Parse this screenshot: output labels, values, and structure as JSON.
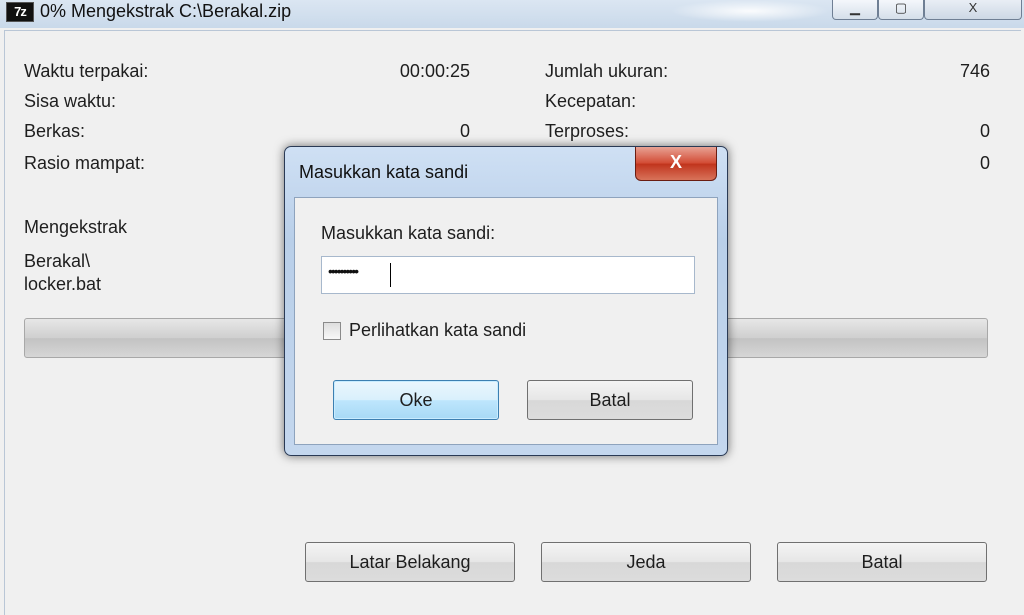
{
  "window": {
    "icon_text": "7z",
    "title": "0% Mengekstrak C:\\Berakal.zip",
    "minimize_glyph": "▁",
    "maximize_glyph": "▢",
    "close_glyph": "X"
  },
  "stats": {
    "elapsed_label": "Waktu terpakai:",
    "elapsed_value": "00:00:25",
    "remaining_label": "Sisa waktu:",
    "files_label": "Berkas:",
    "files_value": "0",
    "ratio_label": "Rasio mampat:",
    "total_size_label": "Jumlah ukuran:",
    "total_size_value": "746",
    "speed_label": "Kecepatan:",
    "processed_label": "Terproses:",
    "processed_value": "0",
    "right_row4_value": "0"
  },
  "status": {
    "action": "Mengekstrak",
    "path_line1": "Berakal\\",
    "path_line2": "locker.bat",
    "progress": 0
  },
  "buttons": {
    "background": "Latar Belakang",
    "pause": "Jeda",
    "cancel": "Batal"
  },
  "password_dialog": {
    "title": "Masukkan kata sandi",
    "close_glyph": "X",
    "prompt": "Masukkan kata sandi:",
    "password_masked": "••••••••••",
    "show_password_label": "Perlihatkan kata sandi",
    "show_password_checked": false,
    "ok_label": "Oke",
    "cancel_label": "Batal"
  },
  "colors": {
    "window_bg": "#f0f0f0",
    "dialog_close_red": "#c0331c",
    "primary_button_blue": "#3c7fb1"
  }
}
